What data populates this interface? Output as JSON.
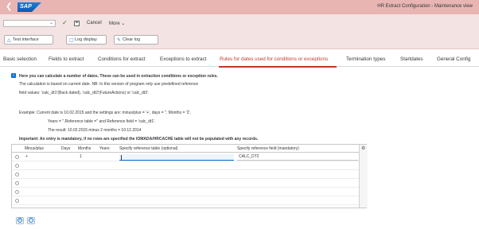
{
  "titlebar": {
    "logo_text": "SAP",
    "title": "HR Extract Configuration - Maintenance view"
  },
  "toolbar1": {
    "command_field_value": "",
    "cancel_label": "Cancel",
    "more_label": "More"
  },
  "toolbar2": {
    "test_interface_label": "Test interface",
    "log_display_label": "Log display",
    "clear_log_label": "Clear log"
  },
  "tabs": [
    {
      "label": "Basic selection",
      "active": false
    },
    {
      "label": "Fields to extract",
      "active": false
    },
    {
      "label": "Conditions for extract",
      "active": false
    },
    {
      "label": "Exceptions to extract",
      "active": false
    },
    {
      "label": "Rules for dates used for conditions or exceptions",
      "active": true
    },
    {
      "label": "Termination types",
      "active": false
    },
    {
      "label": "Startdates",
      "active": false
    },
    {
      "label": "General Config",
      "active": false
    }
  ],
  "content": {
    "info_line1": "Here you can calculate a number of dates. These can be used in extraction conditions or exception rules.",
    "info_line2": "The calculation is based on current date. NB: In this version of program only use predefined reference",
    "info_line3": "field values: 'calc_dt1'(Back dated), 'calc_dt2'(FutureActions) or 'calc_dt3'.",
    "example_line1": "Example: Current date is 10.02.2015 and the settings are: minus/plus = '+', days = '', Months = '2',",
    "example_line2": "Years = '',Reference table ='' and Reference field = 'calc_dt1'.",
    "example_line3": "The result: 10.02.2015 minus 2 months = 10.12.2014",
    "important": "Important: An entry is mandatory, if no rows are specified the IOMADA/HRCACHE table will not be populated with any records."
  },
  "table": {
    "columns": [
      "Minus/plus",
      "Days",
      "Months",
      "Years",
      "Specify reference table (optional)",
      "Specify reference field (mandatory)"
    ],
    "rows": [
      {
        "minus_plus": "+",
        "days": "",
        "months": "1",
        "years": "",
        "ref_table": "",
        "ref_field": "CALC_DT2"
      }
    ]
  },
  "icons": {
    "back": "back-icon",
    "check": "check-icon",
    "save": "save-icon",
    "info": "info-icon",
    "settings": "settings-icon",
    "add_row": "add-row-icon",
    "remove_row": "remove-row-icon"
  },
  "colors": {
    "header_bg": "#e8b5b3",
    "toolbar_bg": "#f4e3e3",
    "active_tab": "#c0392b",
    "sap_blue": "#0a6ed1"
  }
}
